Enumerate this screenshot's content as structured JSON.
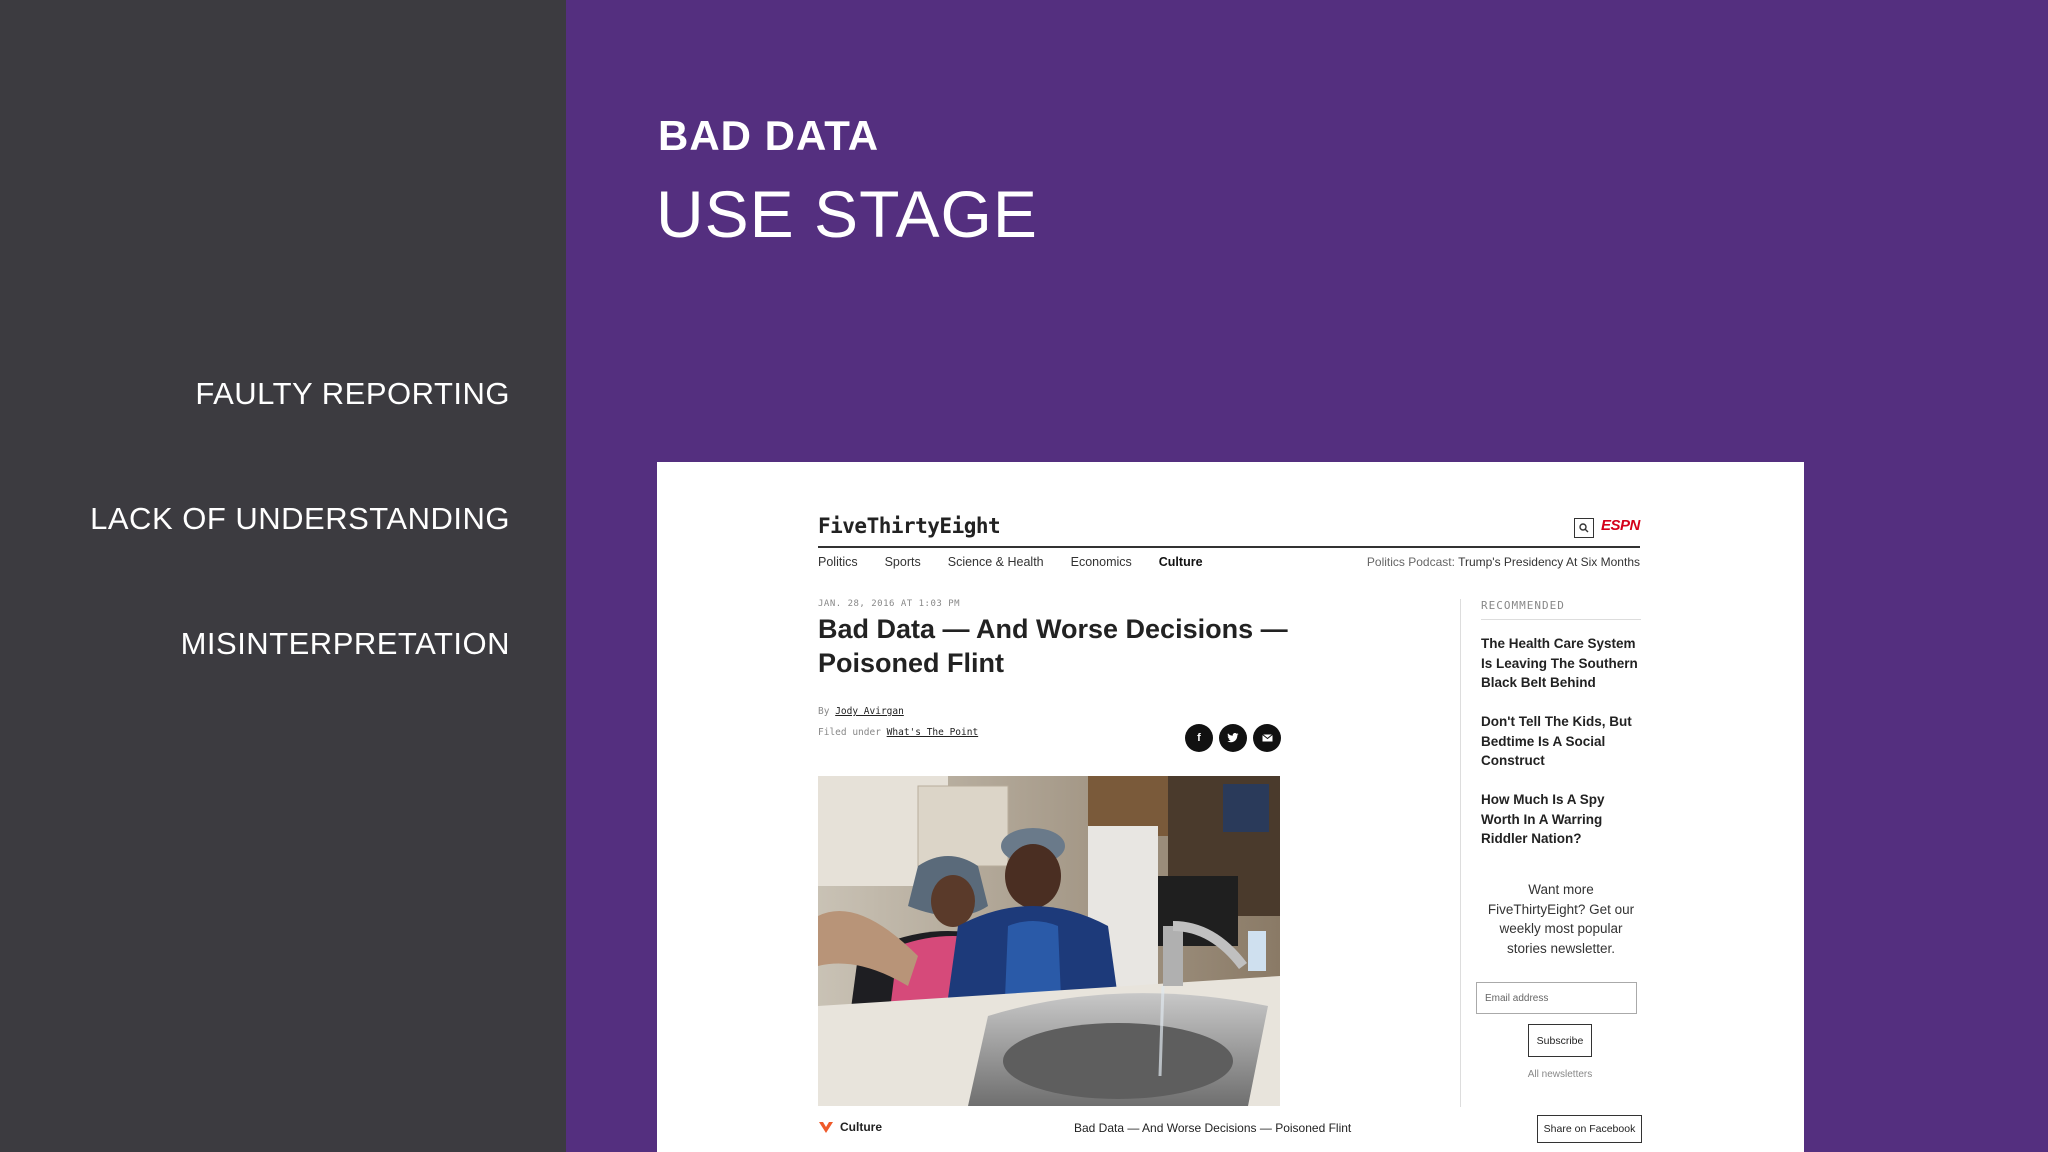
{
  "sidebar": {
    "items": [
      "FAULTY REPORTING",
      "LACK OF UNDERSTANDING",
      "MISINTERPRETATION"
    ]
  },
  "slide": {
    "title": "BAD DATA",
    "subtitle": "USE STAGE"
  },
  "article_page": {
    "site_name": "FiveThirtyEight",
    "partner": "ESPN",
    "nav": [
      "Politics",
      "Sports",
      "Science & Health",
      "Economics",
      "Culture"
    ],
    "active_nav": "Culture",
    "podcast_label": "Politics Podcast:",
    "podcast_title": "Trump's Presidency At Six Months",
    "dateline": "JAN. 28, 2016 AT 1:03 PM",
    "headline": "Bad Data — And Worse Decisions — Poisoned Flint",
    "byline_prefix": "By",
    "author": "Jody Avirgan",
    "filed_prefix": "Filed under",
    "filed_under": "What's The Point",
    "share_icons": [
      "facebook-icon",
      "twitter-icon",
      "email-icon"
    ],
    "recommended_label": "RECOMMENDED",
    "recommended": [
      "The Health Care System Is Leaving The Southern Black Belt Behind",
      "Don't Tell The Kids, But Bedtime Is A Social Construct",
      "How Much Is A Spy Worth In A Warring Riddler Nation?"
    ],
    "newsletter_text": "Want more FiveThirtyEight? Get our weekly most popular stories newsletter.",
    "email_placeholder": "Email address",
    "subscribe_label": "Subscribe",
    "all_newsletters": "All newsletters",
    "footer_section": "Culture",
    "footer_title": "Bad Data — And Worse Decisions — Poisoned Flint",
    "share_facebook": "Share on Facebook"
  },
  "colors": {
    "left_panel": "#3c3b40",
    "right_panel": "#542f7f",
    "espn_red": "#d4001a"
  }
}
